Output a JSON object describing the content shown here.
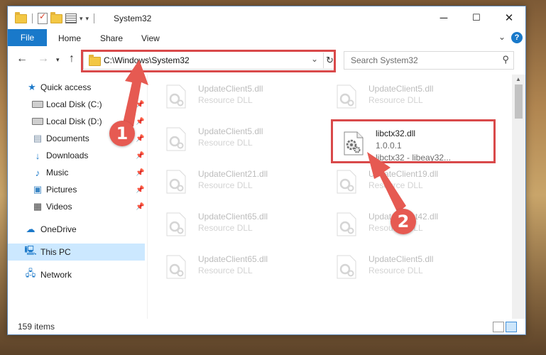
{
  "window": {
    "title": "System32",
    "controls": {
      "minimize": "─",
      "maximize": "☐",
      "close": "✕"
    }
  },
  "ribbon": {
    "tabs": [
      "File",
      "Home",
      "Share",
      "View"
    ],
    "help": "?"
  },
  "navigation": {
    "address": "C:\\Windows\\System32",
    "search_placeholder": "Search System32"
  },
  "sidebar": {
    "items": [
      {
        "label": "Quick access",
        "icon": "star-icon",
        "pinned": false
      },
      {
        "label": "Local Disk (C:)",
        "icon": "drive-icon",
        "pinned": true
      },
      {
        "label": "Local Disk (D:)",
        "icon": "drive-icon",
        "pinned": true
      },
      {
        "label": "Documents",
        "icon": "documents-icon",
        "pinned": true
      },
      {
        "label": "Downloads",
        "icon": "downloads-icon",
        "pinned": true
      },
      {
        "label": "Music",
        "icon": "music-icon",
        "pinned": true
      },
      {
        "label": "Pictures",
        "icon": "pictures-icon",
        "pinned": true
      },
      {
        "label": "Videos",
        "icon": "videos-icon",
        "pinned": true
      },
      {
        "label": "OneDrive",
        "icon": "cloud-icon",
        "pinned": false
      },
      {
        "label": "This PC",
        "icon": "computer-icon",
        "pinned": false,
        "selected": true
      },
      {
        "label": "Network",
        "icon": "network-icon",
        "pinned": false
      }
    ]
  },
  "files": [
    {
      "name": "UpdateClient5.dll",
      "desc": "Resource DLL"
    },
    {
      "name": "UpdateClient5.dll",
      "desc": "Resource DLL"
    },
    {
      "name": "UpdateClient5.dll",
      "desc": "Resource DLL"
    },
    {
      "name": "libctx32.dll",
      "version": "1.0.0.1",
      "desc": "libctx32 - libeay32...",
      "featured": true
    },
    {
      "name": "UpdateClient21.dll",
      "desc": "Resource DLL"
    },
    {
      "name": "UpdateClient19.dll",
      "desc": "Resource DLL"
    },
    {
      "name": "UpdateClient65.dll",
      "desc": "Resource DLL"
    },
    {
      "name": "UpdateClient42.dll",
      "desc": "Resource DLL"
    },
    {
      "name": "UpdateClient65.dll",
      "desc": "Resource DLL"
    },
    {
      "name": "UpdateClient5.dll",
      "desc": "Resource DLL"
    }
  ],
  "status": {
    "item_count": "159 items"
  },
  "annotations": {
    "step1": "1",
    "step2": "2",
    "color": "#e65a52"
  }
}
